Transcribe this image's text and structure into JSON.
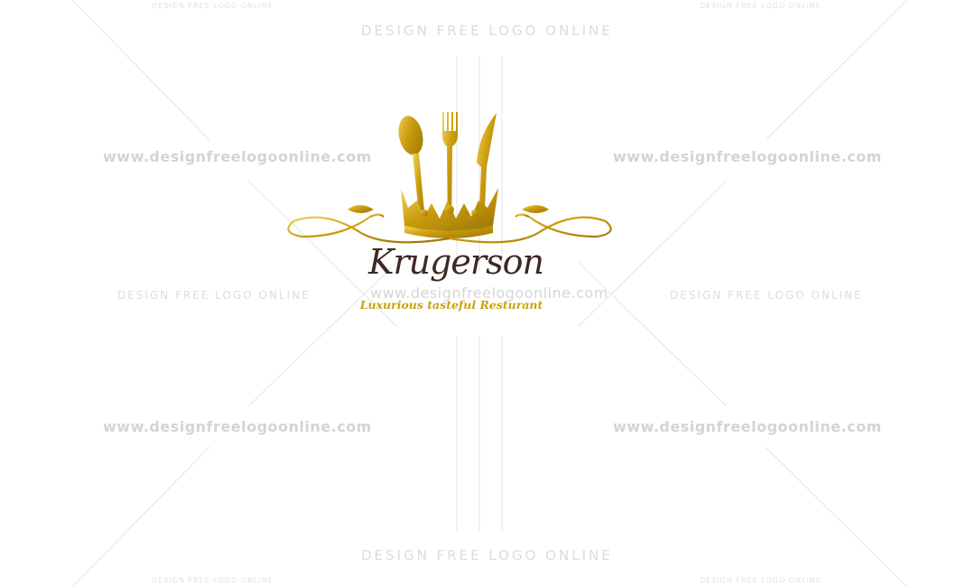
{
  "watermark": {
    "text": "DESIGN FREE LOGO ONLINE",
    "url": "www.designfreelogoonline.com",
    "color": "#dcdcdc"
  },
  "logo": {
    "brand_name": "Krugerson",
    "tagline": "Luxurious tasteful Resturant",
    "icon": "crown-with-spoon-fork-knife-icon",
    "gold": "#c9a20f",
    "brown": "#3d2a22"
  }
}
